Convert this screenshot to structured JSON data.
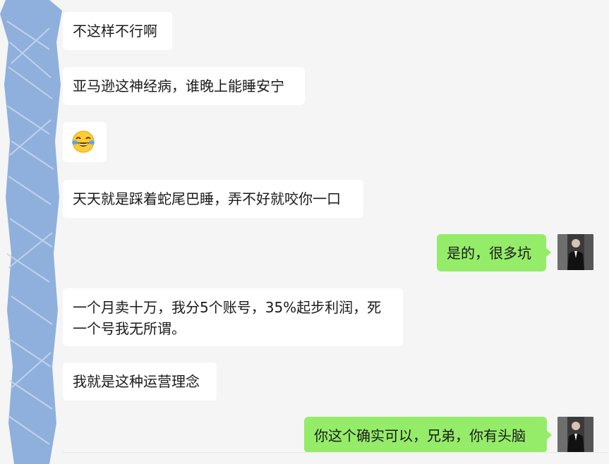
{
  "colors": {
    "background": "#f5f5f5",
    "incoming_bubble": "#ffffff",
    "outgoing_bubble": "#95ec69",
    "redaction": "#8fb0dc",
    "text": "#1a1a1a"
  },
  "chat": {
    "messages": [
      {
        "side": "incoming",
        "text": "不这样不行啊"
      },
      {
        "side": "incoming",
        "text": "亚马逊这神经病，谁晚上能睡安宁"
      },
      {
        "side": "incoming",
        "emoji": "face-with-tears-of-joy-icon"
      },
      {
        "side": "incoming",
        "text": "天天就是踩着蛇尾巴睡，弄不好就咬你一口"
      },
      {
        "side": "outgoing",
        "text": "是的，很多坑"
      },
      {
        "side": "incoming",
        "text": "一个月卖十万，我分5个账号，35%起步利润，死一个号我无所谓。"
      },
      {
        "side": "incoming",
        "text": "我就是这种运营理念"
      },
      {
        "side": "outgoing",
        "text": "你这个确实可以，兄弟，你有头脑"
      }
    ]
  }
}
